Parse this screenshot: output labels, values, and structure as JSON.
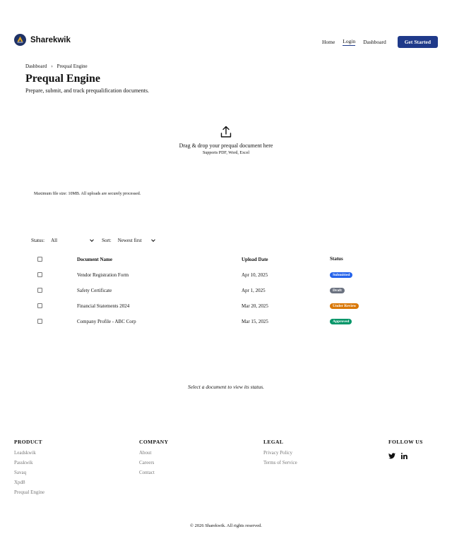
{
  "brand": {
    "name": "Sharekwik"
  },
  "nav": {
    "home": "Home",
    "login": "Login",
    "dashboard": "Dashboard",
    "cta": "Get Started"
  },
  "breadcrumb": {
    "parent": "Dashboard",
    "current": "Prequal Engine",
    "separator": "›"
  },
  "page": {
    "title": "Prequal Engine",
    "subtitle": "Prepare, submit, and track prequalification documents."
  },
  "upload": {
    "prompt": "Drag & drop your prequal document here",
    "formats": "Supports PDF, Word, Excel",
    "note": "Maximum file size: 10MB. All uploads are securely processed."
  },
  "filters": {
    "status_label": "Status:",
    "status_value": "All",
    "sort_label": "Sort:",
    "sort_value": "Newest first"
  },
  "table": {
    "columns": [
      "Document Name",
      "Upload Date",
      "Status"
    ],
    "rows": [
      {
        "name": "Vendor Registration Form",
        "date": "Apr 10, 2025",
        "status": "Submitted",
        "color": "#2563eb"
      },
      {
        "name": "Safety Certificate",
        "date": "Apr 1, 2025",
        "status": "Draft",
        "color": "#6b7280"
      },
      {
        "name": "Financial Statements 2024",
        "date": "Mar 20, 2025",
        "status": "Under Review",
        "color": "#d97706"
      },
      {
        "name": "Company Profile - ABC Corp",
        "date": "Mar 15, 2025",
        "status": "Approved",
        "color": "#059669"
      }
    ]
  },
  "hint": "Select a document to view its status.",
  "footer": {
    "product": {
      "heading": "PRODUCT",
      "links": [
        "Leadskwik",
        "Passkwik",
        "Savaq",
        "Xpd8",
        "Prequal Engine"
      ]
    },
    "company": {
      "heading": "COMPANY",
      "links": [
        "About",
        "Careers",
        "Contact"
      ]
    },
    "legal": {
      "heading": "LEGAL",
      "links": [
        "Privacy Policy",
        "Terms of Service"
      ]
    },
    "social": {
      "heading": "FOLLOW US",
      "icons": [
        "twitter-icon",
        "linkedin-icon"
      ]
    },
    "copyright": "© 2026 Sharekwik. All rights reserved."
  },
  "colors": {
    "primary": "#1f3a8a",
    "muted_link": "#777777"
  }
}
